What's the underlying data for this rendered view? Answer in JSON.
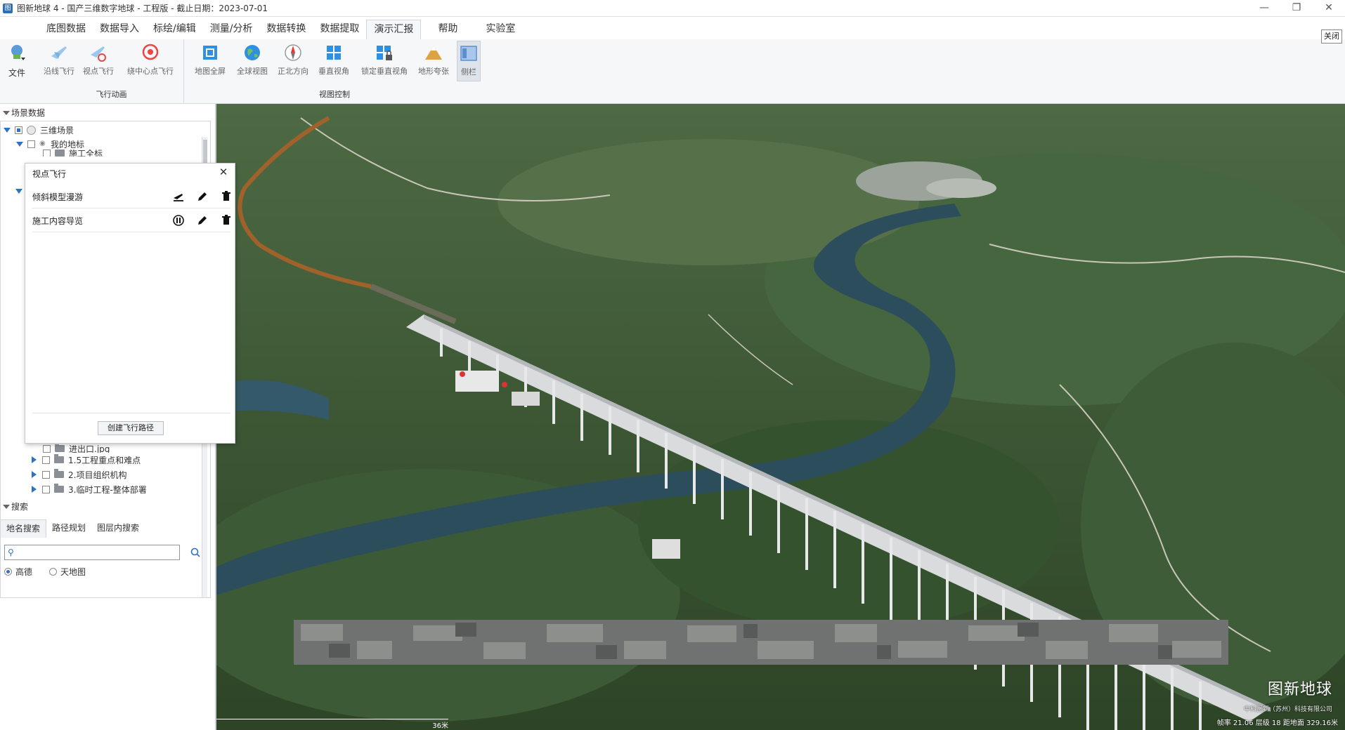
{
  "window": {
    "title": "图新地球 4 - 国产三维数字地球 - 工程版 - 截止日期：2023-07-01",
    "controls": [
      "—",
      "❐",
      "✕"
    ]
  },
  "menu": {
    "items": [
      "底图数据",
      "数据导入",
      "标绘/编辑",
      "测量/分析",
      "数据转换",
      "数据提取",
      "演示汇报",
      "帮助",
      "实验室"
    ],
    "active": "演示汇报"
  },
  "ribbon": {
    "file_label": "文件",
    "flight_group": {
      "label": "飞行动画",
      "buttons": [
        "沿线飞行",
        "视点飞行",
        "绕中心点飞行"
      ]
    },
    "view_group": {
      "label": "视图控制",
      "buttons": [
        "地图全屏",
        "全球视图",
        "正北方向",
        "垂直视角",
        "锁定垂直视角",
        "地形夸张",
        "侧栏"
      ]
    },
    "close_label": "关闭"
  },
  "left_panel": {
    "scene_header": "场景数据",
    "tree": [
      {
        "label": "三维场景",
        "level": 0,
        "expanded": true
      },
      {
        "label": "我的地标",
        "level": 1,
        "expanded": true
      },
      {
        "label": "施工全标",
        "level": 2
      },
      {
        "label": "进出口.jpg",
        "level": 2
      },
      {
        "label": "1.5工程重点和难点",
        "level": 2,
        "expanded": false
      },
      {
        "label": "2.项目组织机构",
        "level": 2,
        "expanded": false
      },
      {
        "label": "3.临时工程-整体部署",
        "level": 2,
        "expanded": false
      }
    ],
    "search_header": "搜索",
    "search_tabs": [
      "地名搜索",
      "路径规划",
      "图层内搜索"
    ],
    "search_placeholder": "",
    "map_sources": [
      "高德",
      "天地图"
    ],
    "map_source_selected": "高德"
  },
  "popup": {
    "title": "视点飞行",
    "rows": [
      {
        "label": "倾斜模型漫游",
        "play_icon": "fly-icon"
      },
      {
        "label": "施工内容导览",
        "play_icon": "pause-icon"
      }
    ],
    "create_label": "创建飞行路径"
  },
  "viewport": {
    "watermark_title": "图新地球",
    "watermark_sub": "中科图新（苏州）科技有限公司",
    "scale_text": "36米",
    "status_text": "帧率 21.06   层级 18   距地面 329.16米"
  },
  "colors": {
    "accent": "#2e72c8",
    "ribbon_bg": "#f6f7f9",
    "terrain_dark": "#2f4a2a",
    "river": "#2c4d5c"
  }
}
